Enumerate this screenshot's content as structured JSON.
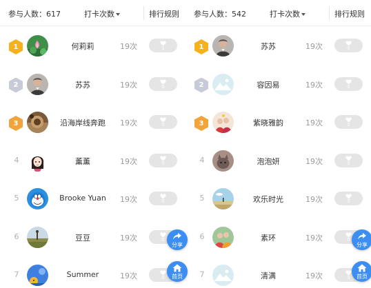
{
  "panels": [
    {
      "participants_label": "参与人数：617",
      "sort_label": "打卡次数",
      "rules_label": "排行规则",
      "rows": [
        {
          "rank": "1",
          "medal": "gold",
          "avatar": "lotus-pond",
          "name": "何莉莉",
          "times": "19次",
          "likes": "1"
        },
        {
          "rank": "2",
          "medal": "silver",
          "avatar": "man-portrait",
          "name": "苏苏",
          "times": "19次",
          "likes": "0"
        },
        {
          "rank": "3",
          "medal": "bronze",
          "avatar": "sepia-photo",
          "name": "沿海岸线奔跑",
          "times": "19次",
          "likes": "0"
        },
        {
          "rank": "4",
          "medal": "",
          "avatar": "cartoon-girl",
          "name": "薰薰",
          "times": "19次",
          "likes": "0"
        },
        {
          "rank": "5",
          "medal": "",
          "avatar": "doraemon",
          "name": "Brooke Yuan",
          "times": "19次",
          "likes": "0"
        },
        {
          "rank": "6",
          "medal": "",
          "avatar": "field-landscape",
          "name": "豆豆",
          "times": "19次",
          "likes": "0"
        },
        {
          "rank": "7",
          "medal": "",
          "avatar": "blue-cartoon",
          "name": "Summer",
          "times": "19次",
          "likes": "0"
        }
      ]
    },
    {
      "participants_label": "参与人数：542",
      "sort_label": "打卡次数",
      "rules_label": "排行规则",
      "rows": [
        {
          "rank": "1",
          "medal": "gold",
          "avatar": "man-portrait",
          "name": "苏苏",
          "times": "19次",
          "likes": "0"
        },
        {
          "rank": "2",
          "medal": "silver",
          "avatar": "default-mountain",
          "name": "容因易",
          "times": "19次",
          "likes": "0"
        },
        {
          "rank": "3",
          "medal": "bronze",
          "avatar": "party-photo",
          "name": "紫晓雅韵",
          "times": "19次",
          "likes": "0"
        },
        {
          "rank": "4",
          "medal": "",
          "avatar": "cat-photo",
          "name": "泡泡妍",
          "times": "19次",
          "likes": "0"
        },
        {
          "rank": "5",
          "medal": "",
          "avatar": "sky-landscape",
          "name": "欢乐时光",
          "times": "19次",
          "likes": "0"
        },
        {
          "rank": "6",
          "medal": "",
          "avatar": "couple-photo",
          "name": "素环",
          "times": "19次",
          "likes": "0"
        },
        {
          "rank": "7",
          "medal": "",
          "avatar": "default-mountain",
          "name": "清满",
          "times": "19次",
          "likes": "0"
        }
      ]
    }
  ],
  "fab": {
    "share_label": "分享",
    "home_label": "首页"
  },
  "colors": {
    "accent": "#3d8ef2",
    "gold": "#f5b21f",
    "silver": "#c7cbd8",
    "bronze": "#f2a33a",
    "like_bg": "#e5e5e5"
  }
}
